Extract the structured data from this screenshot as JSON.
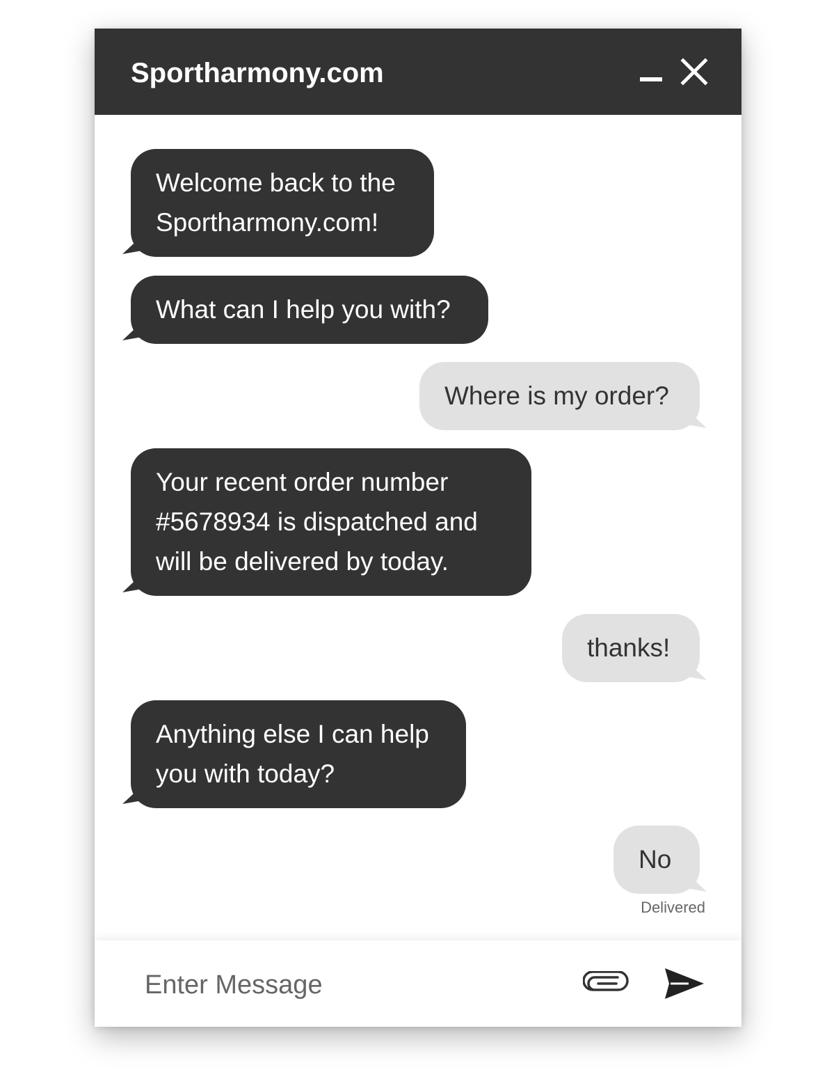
{
  "header": {
    "title": "Sportharmony.com"
  },
  "messages": [
    {
      "sender": "bot",
      "text": "Welcome back to the\nSportharmony.com!"
    },
    {
      "sender": "bot",
      "text": "What can I help you with?"
    },
    {
      "sender": "user",
      "text": "Where is my order?"
    },
    {
      "sender": "bot",
      "text": "Your recent order number\n#5678934 is dispatched and\nwill be delivered by today."
    },
    {
      "sender": "user",
      "text": "thanks!"
    },
    {
      "sender": "bot",
      "text": "Anything else I can help\nyou with today?"
    },
    {
      "sender": "user",
      "text": "No"
    }
  ],
  "status": {
    "delivered": "Delivered"
  },
  "composer": {
    "placeholder": "Enter Message",
    "value": ""
  },
  "icons": {
    "minimize": "minimize-icon",
    "close": "close-icon",
    "attach": "paperclip-icon",
    "send": "send-icon"
  },
  "colors": {
    "header": "#333333",
    "bot_bubble": "#333333",
    "user_bubble": "#e1e1e1",
    "bot_text": "#ffffff",
    "user_text": "#333333"
  }
}
